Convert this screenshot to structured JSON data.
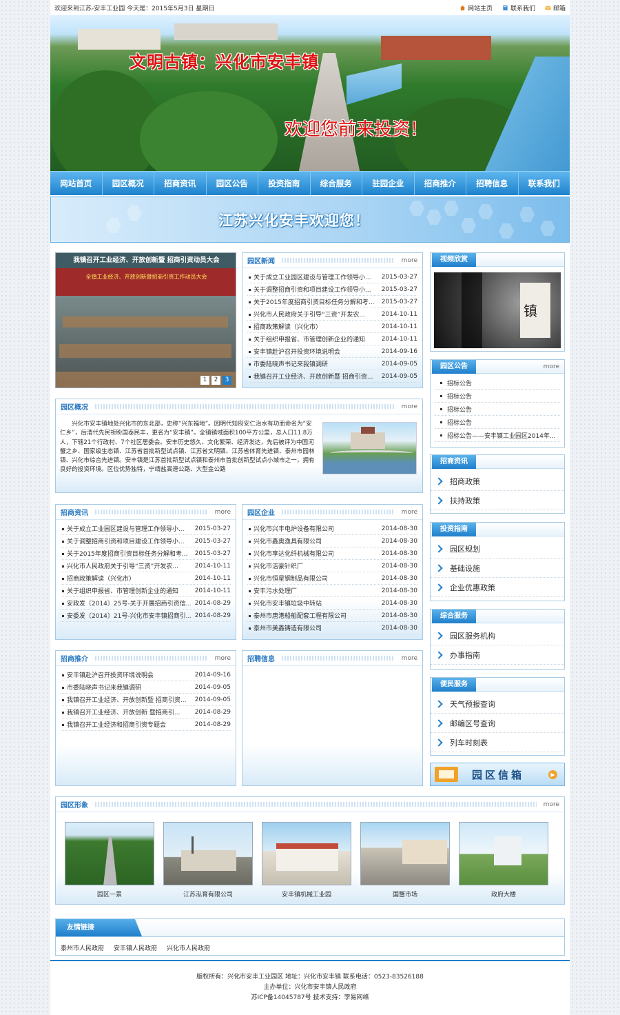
{
  "topbar": {
    "welcome": "欢迎来到江苏-安丰工业园 今天是：2015年5月3日 星期日",
    "home": "网站主页",
    "contact": "联系我们",
    "mail": "邮箱"
  },
  "banner": {
    "title": "文明古镇：兴化市安丰镇",
    "slogan": "欢迎您前来投资！"
  },
  "nav": [
    "网站首页",
    "园区概况",
    "招商资讯",
    "园区公告",
    "投资指南",
    "综合服务",
    "驻园企业",
    "招商推介",
    "招聘信息",
    "联系我们"
  ],
  "welcome_text": "江苏兴化安丰欢迎您！",
  "slide": {
    "caption": "我镇召开工业经济、开放创新暨 招商引资动员大会",
    "banner_text": "全镇工业经济、开放创新暨招商引资工作动员大会",
    "pages": [
      "1",
      "2",
      "3"
    ]
  },
  "more": "more",
  "news": {
    "title": "园区新闻",
    "items": [
      {
        "t": "关于成立工业园区建设与管理工作领导小...",
        "d": "2015-03-27"
      },
      {
        "t": "关于调整招商引资和项目建设工作领导小...",
        "d": "2015-03-27"
      },
      {
        "t": "关于2015年度招商引资目标任务分解和考...",
        "d": "2015-03-27"
      },
      {
        "t": "兴化市人民政府关于引导“三资”开发农...",
        "d": "2014-10-11"
      },
      {
        "t": "招商政策解读（兴化市）",
        "d": "2014-10-11"
      },
      {
        "t": "关于组织申报省、市管理创新企业的通知",
        "d": "2014-10-11"
      },
      {
        "t": "安丰镇赴沪召开投资环境说明会",
        "d": "2014-09-16"
      },
      {
        "t": "市委陆晓声书记来我镇调研",
        "d": "2014-09-05"
      },
      {
        "t": "我镇召开工业经济、开放创新暨 招商引资...",
        "d": "2014-09-05"
      }
    ]
  },
  "overview": {
    "title": "园区概况",
    "text": "　　兴化市安丰镇地处兴化市的东北部，史称“兴东福地”。因明代知府安仁治水有功而命名为“安仁乡”，后清代先民祈盼国泰民丰，更名为“安丰镇”。全镇镇域面积100平方公里，总人口11.8万人，下辖21个行政村、7个社区居委会。安丰历史悠久、文化繁荣、经济发达，先后被评为中国河蟹之乡、国家级生态镇、江苏省首批新型试点镇、江苏省文明镇、江苏省体育先进镇、泰州市园林镇、兴化市综合先进镇。安丰镇是江苏首批新型试点镇和泰州市首批创新型试点小城市之一，拥有良好的投资环境。区位优势独特，宁靖盐高速公路、大型金公路"
  },
  "invest_news": {
    "title": "招商资讯",
    "items": [
      {
        "t": "关于成立工业园区建设与管理工作领导小...",
        "d": "2015-03-27"
      },
      {
        "t": "关于调整招商引资和项目建设工作领导小...",
        "d": "2015-03-27"
      },
      {
        "t": "关于2015年度招商引资目标任务分解和考...",
        "d": "2015-03-27"
      },
      {
        "t": "兴化市人民政府关于引导“三资”开发农...",
        "d": "2014-10-11"
      },
      {
        "t": "招商政策解读（兴化市）",
        "d": "2014-10-11"
      },
      {
        "t": "关于组织申报省、市管理创新企业的通知",
        "d": "2014-10-11"
      },
      {
        "t": "安政发〔2014〕25号-关于开展招商引资信...",
        "d": "2014-08-29"
      },
      {
        "t": "安委发〔2014〕21号-兴化市安丰镇招商引...",
        "d": "2014-08-29"
      }
    ]
  },
  "companies": {
    "title": "园区企业",
    "items": [
      {
        "t": "兴化市兴丰电炉设备有限公司",
        "d": "2014-08-30"
      },
      {
        "t": "兴化市鑫奥渔具有限公司",
        "d": "2014-08-30"
      },
      {
        "t": "兴化市享达化纤机械有限公司",
        "d": "2014-08-30"
      },
      {
        "t": "兴化市洁豪针织厂",
        "d": "2014-08-30"
      },
      {
        "t": "兴化市恒星钢制品有限公司",
        "d": "2014-08-30"
      },
      {
        "t": "安丰污水处理厂",
        "d": "2014-08-30"
      },
      {
        "t": "兴化市安丰镇垃圾中转站",
        "d": "2014-08-30"
      },
      {
        "t": "泰州市唐港船舶配套工程有限公司",
        "d": "2014-08-30"
      },
      {
        "t": "泰州市美鑫铸造有限公司",
        "d": "2014-08-30"
      }
    ]
  },
  "promotion": {
    "title": "招商推介",
    "items": [
      {
        "t": "安丰镇赴沪召开投资环境说明会",
        "d": "2014-09-16"
      },
      {
        "t": "市委陆晓声书记来我镇调研",
        "d": "2014-09-05"
      },
      {
        "t": "我镇召开工业经济、开放创新暨 招商引资...",
        "d": "2014-09-05"
      },
      {
        "t": "我镇召开工业经济、开放创新 暨招商引...",
        "d": "2014-08-29"
      },
      {
        "t": "我镇召开工业经济和招商引资专题会",
        "d": "2014-08-29"
      }
    ]
  },
  "jobs": {
    "title": "招聘信息"
  },
  "side": {
    "video": {
      "title": "视频欣赏",
      "art": "镇"
    },
    "notice": {
      "title": "园区公告",
      "items": [
        "招标公告",
        "招标公告",
        "招标公告",
        "招标公告",
        "招标公告——安丰镇工业园区2014年..."
      ]
    },
    "invest": {
      "title": "招商资讯",
      "items": [
        "招商政策",
        "扶持政策"
      ]
    },
    "guide": {
      "title": "投资指南",
      "items": [
        "园区规划",
        "基础设施",
        "企业优惠政策"
      ]
    },
    "service": {
      "title": "综合服务",
      "items": [
        "园区服务机构",
        "办事指南"
      ]
    },
    "public": {
      "title": "便民服务",
      "items": [
        "天气预报查询",
        "邮编区号查询",
        "列车时刻表"
      ]
    },
    "mailbox": "园区信箱"
  },
  "gallery": {
    "title": "园区形象",
    "items": [
      "园区一景",
      "江苏泓育有限公司",
      "安丰镇机械工业园",
      "国蟹市场",
      "政府大楼"
    ]
  },
  "links": {
    "title": "友情链接",
    "items": [
      "泰州市人民政府",
      "安丰镇人民政府",
      "兴化市人民政府"
    ]
  },
  "footer": {
    "line1": "版权所有：兴化市安丰工业园区 地址：兴化市安丰镇 联系电话：0523-83526188",
    "line2": "主办单位：兴化市安丰镇人民政府",
    "line3": "苏ICP备14045787号 技术支持：孛易网络"
  }
}
